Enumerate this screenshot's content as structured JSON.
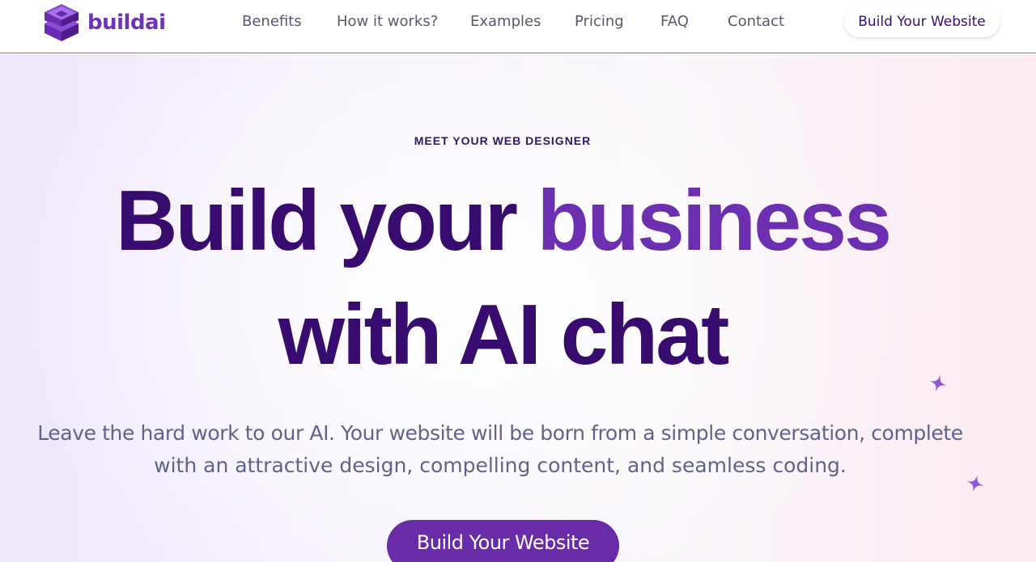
{
  "brand": {
    "name": "buildai",
    "logo_icon": "stacked-cube-logo",
    "color": "#6c33b3"
  },
  "nav": {
    "links": [
      "Benefits",
      "How it works?",
      "Examples",
      "Pricing",
      "FAQ",
      "Contact"
    ],
    "cta_label": "Build Your Website"
  },
  "hero": {
    "eyebrow": "MEET YOUR WEB DESIGNER",
    "headline": {
      "part1": "Build your ",
      "part2": "business",
      "part3": "with AI chat"
    },
    "subcopy": {
      "line1": "Leave the hard work to our AI. Your website will be born from a simple conversation, complete",
      "line2": "with an attractive design, compelling content, and seamless coding."
    },
    "cta_label": "Build Your Website",
    "decorations": [
      "sparkle-icon",
      "sparkle-icon"
    ]
  },
  "colors": {
    "headline_dark": "#380b6e",
    "headline_accent": "#6b2fb0",
    "button": "#6a2ba8",
    "body_text": "#5f6289",
    "nav_text": "#565873"
  }
}
